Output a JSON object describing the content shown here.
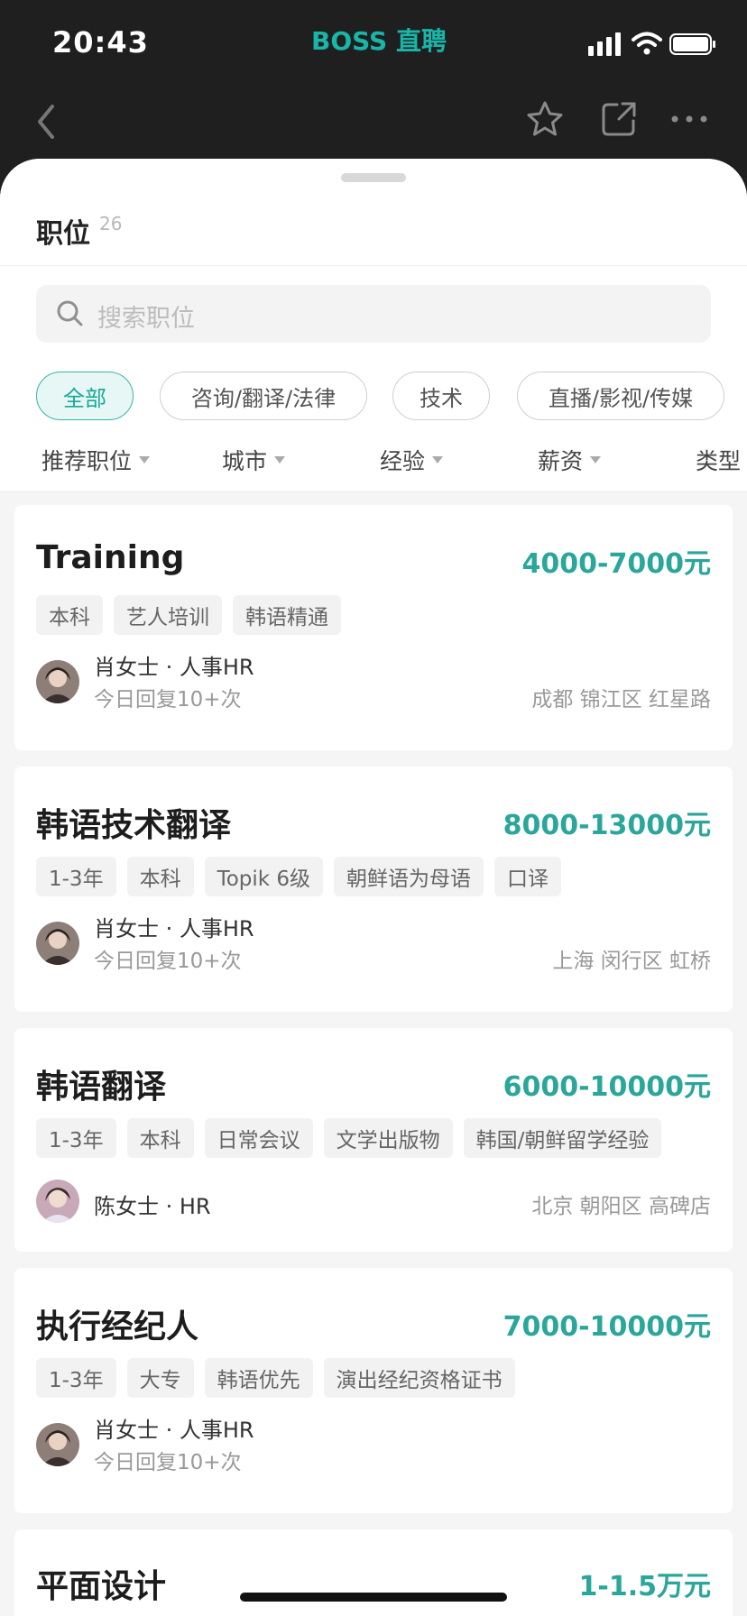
{
  "status": {
    "time": "20:43",
    "brand": "BOSS 直聘"
  },
  "section": {
    "title": "职位",
    "count": "26"
  },
  "search": {
    "placeholder": "搜索职位"
  },
  "chips": [
    "全部",
    "咨询/翻译/法律",
    "技术",
    "直播/影视/传媒"
  ],
  "filters": [
    "推荐职位",
    "城市",
    "经验",
    "薪资",
    "类型"
  ],
  "jobs": [
    {
      "title": "Training",
      "salary": "4000-7000元",
      "tags": [
        "本科",
        "艺人培训",
        "韩语精通"
      ],
      "hr": "肖女士 · 人事HR",
      "reply": "今日回复10+次",
      "location": "成都 锦江区 红星路"
    },
    {
      "title": "韩语技术翻译",
      "salary": "8000-13000元",
      "tags": [
        "1-3年",
        "本科",
        "Topik 6级",
        "朝鲜语为母语",
        "口译"
      ],
      "hr": "肖女士 · 人事HR",
      "reply": "今日回复10+次",
      "location": "上海 闵行区 虹桥"
    },
    {
      "title": "韩语翻译",
      "salary": "6000-10000元",
      "tags": [
        "1-3年",
        "本科",
        "日常会议",
        "文学出版物",
        "韩国/朝鲜留学经验"
      ],
      "hr": "陈女士 · HR",
      "reply": "",
      "location": "北京 朝阳区 高碑店"
    },
    {
      "title": "执行经纪人",
      "salary": "7000-10000元",
      "tags": [
        "1-3年",
        "大专",
        "韩语优先",
        "演出经纪资格证书"
      ],
      "hr": "肖女士 · 人事HR",
      "reply": "今日回复10+次",
      "location": ""
    },
    {
      "title": "平面设计",
      "salary": "1-1.5万元",
      "tags": [],
      "hr": "",
      "reply": "",
      "location": ""
    }
  ],
  "colors": {
    "accent": "#2aa69a",
    "brand": "#19b5a8"
  }
}
